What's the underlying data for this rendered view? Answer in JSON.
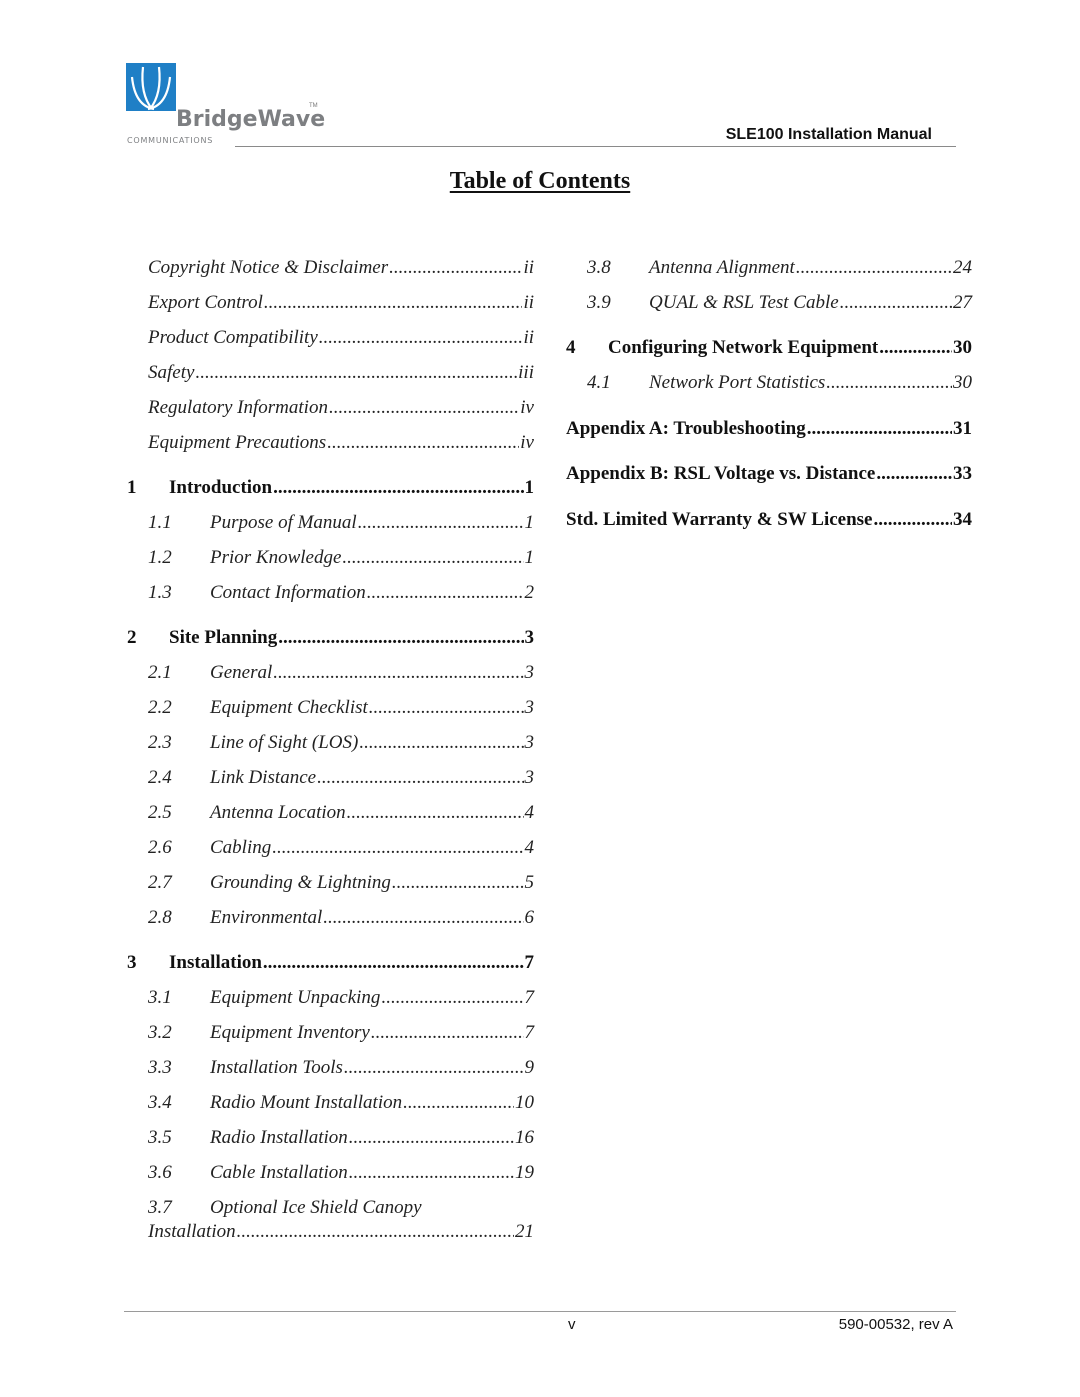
{
  "header": {
    "brand_name": "BridgeWave",
    "brand_trademark": "TM",
    "brand_subtitle": "COMMUNICATIONS",
    "brand_color": "#1f7fc6",
    "manual_title": "SLE100 Installation Manual"
  },
  "title": "Table of Contents",
  "toc": {
    "front_matter": [
      {
        "label": "Copyright Notice & Disclaimer",
        "page": "ii"
      },
      {
        "label": "Export Control",
        "page": "ii"
      },
      {
        "label": "Product Compatibility",
        "page": "ii"
      },
      {
        "label": "Safety",
        "page": "iii"
      },
      {
        "label": "Regulatory Information",
        "page": "iv"
      },
      {
        "label": "Equipment Precautions",
        "page": "iv"
      }
    ],
    "chapters": [
      {
        "num": "1",
        "label": "Introduction",
        "page": "1",
        "sections": [
          {
            "num": "1.1",
            "label": "Purpose of Manual",
            "page": "1"
          },
          {
            "num": "1.2",
            "label": "Prior Knowledge",
            "page": "1"
          },
          {
            "num": "1.3",
            "label": "Contact Information",
            "page": "2"
          }
        ]
      },
      {
        "num": "2",
        "label": "Site Planning",
        "page": "3",
        "sections": [
          {
            "num": "2.1",
            "label": "General",
            "page": "3"
          },
          {
            "num": "2.2",
            "label": "Equipment Checklist",
            "page": "3"
          },
          {
            "num": "2.3",
            "label": "Line of Sight (LOS)",
            "page": "3"
          },
          {
            "num": "2.4",
            "label": "Link Distance",
            "page": "3"
          },
          {
            "num": "2.5",
            "label": "Antenna Location",
            "page": "4"
          },
          {
            "num": "2.6",
            "label": "Cabling",
            "page": "4"
          },
          {
            "num": "2.7",
            "label": "Grounding & Lightning",
            "page": "5"
          },
          {
            "num": "2.8",
            "label": "Environmental",
            "page": "6"
          }
        ]
      },
      {
        "num": "3",
        "label": "Installation",
        "page": "7",
        "sections": [
          {
            "num": "3.1",
            "label": "Equipment Unpacking",
            "page": "7"
          },
          {
            "num": "3.2",
            "label": "Equipment Inventory",
            "page": "7"
          },
          {
            "num": "3.3",
            "label": "Installation Tools",
            "page": "9"
          },
          {
            "num": "3.4",
            "label": "Radio Mount Installation",
            "page": "10"
          },
          {
            "num": "3.5",
            "label": "Radio Installation",
            "page": "16"
          },
          {
            "num": "3.6",
            "label": "Cable Installation",
            "page": "19"
          },
          {
            "num": "3.7",
            "label": "Optional Ice Shield Canopy",
            "label_cont": "Installation",
            "page": "21"
          },
          {
            "num": "3.8",
            "label": "Antenna Alignment",
            "page": "24"
          },
          {
            "num": "3.9",
            "label": "QUAL & RSL Test Cable",
            "page": "27"
          }
        ]
      },
      {
        "num": "4",
        "label": "Configuring Network Equipment",
        "page": "30",
        "sections": [
          {
            "num": "4.1",
            "label": "Network Port Statistics",
            "page": "30"
          }
        ]
      }
    ],
    "appendices": [
      {
        "label": "Appendix A: Troubleshooting",
        "page": "31"
      },
      {
        "label": "Appendix B: RSL Voltage vs. Distance",
        "page": "33"
      },
      {
        "label": "Std. Limited Warranty & SW License",
        "page": "34"
      }
    ]
  },
  "footer": {
    "page_number": "v",
    "doc_number": "590-00532, rev A"
  }
}
